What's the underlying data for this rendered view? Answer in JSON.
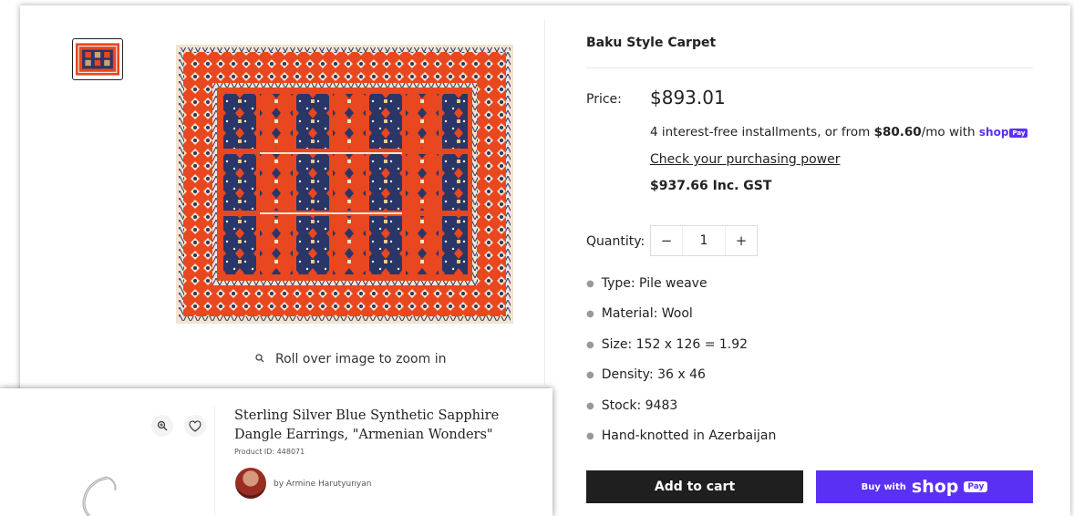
{
  "product": {
    "title": "Baku Style Carpet",
    "price_label": "Price:",
    "price": "$893.01",
    "installments_prefix": "4 interest-free installments, or from ",
    "installments_amount": "$80.60",
    "installments_suffix": "/mo with ",
    "shoppay_text": "shop",
    "shoppay_pay": "Pay",
    "check_power": "Check your purchasing power",
    "gst": "$937.66 Inc. GST",
    "quantity_label": "Quantity:",
    "quantity_value": "1",
    "minus": "−",
    "plus": "+",
    "specs": [
      "Type: Pile weave",
      "Material: Wool",
      "Size: 152 x 126 = 1.92",
      "Density: 36 x 46",
      "Stock: 9483",
      "Hand-knotted in Azerbaijan"
    ],
    "add_to_cart": "Add to cart",
    "buy_with": "Buy with",
    "buy_shop": "shop",
    "buy_pay": "Pay",
    "zoom_hint": "Roll over image to zoom in"
  },
  "overlay_card": {
    "title": "Sterling Silver Blue Synthetic Sapphire Dangle Earrings, \"Armenian Wonders\"",
    "product_id": "Product ID: 448071",
    "author": "by Armine Harutyunyan"
  },
  "colors": {
    "carpet_field": "#e8471f",
    "carpet_blue": "#2a3568",
    "shoppay": "#5a31f4",
    "cart_button": "#1f1f1f"
  },
  "icons": [
    "magnifier-icon",
    "zoom-in-icon",
    "heart-icon",
    "earring-image"
  ]
}
